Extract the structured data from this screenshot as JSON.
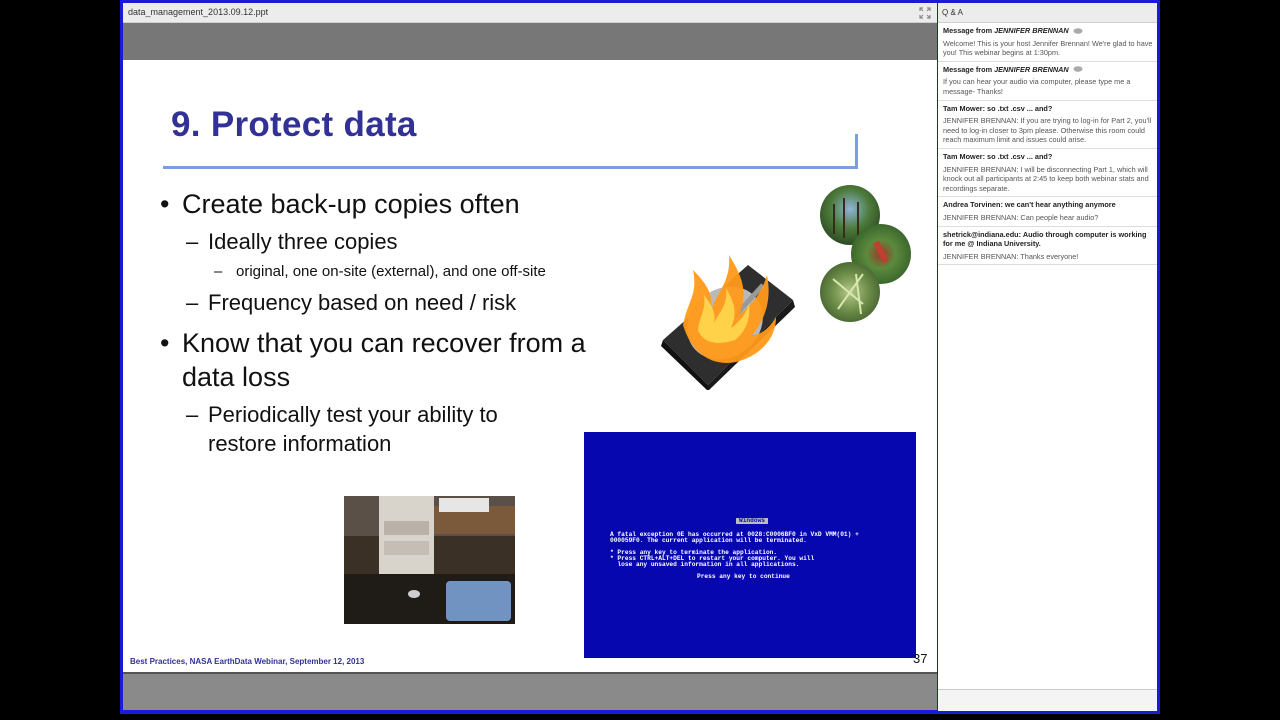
{
  "presentation": {
    "file_name": "data_management_2013.09.12.ppt",
    "expand_icon": "expand-icon"
  },
  "slide": {
    "title": "9.  Protect data",
    "bullets": [
      {
        "text": "Create back-up copies often",
        "sub": [
          {
            "text": "Ideally three copies",
            "subsub": [
              "original, one on-site (external), and one off-site"
            ]
          },
          {
            "text": "Frequency based on need / risk"
          }
        ]
      },
      {
        "text_line1": "Know that you can recover from a",
        "text_line2": "data loss",
        "sub": [
          {
            "line1": "Periodically test your ability to",
            "line2": "restore information"
          }
        ]
      }
    ],
    "footer": "Best Practices, NASA EarthData Webinar, September 12, 2013",
    "page_number": "37",
    "bsod": {
      "badge": "Windows",
      "lines": [
        "A fatal exception 0E has occurred at 0028:C0006BF0 in VxD VMM(01) +",
        "000059F0. The current application will be terminated.",
        "* Press any key to terminate the application.",
        "* Press CTRL+ALT+DEL to restart your computer. You will",
        "  lose any unsaved information in all applications.",
        "Press any key to continue"
      ]
    },
    "colors": {
      "title": "#323296",
      "rule": "#7a9ee0",
      "bsod_bg": "#0707b0"
    }
  },
  "qa": {
    "header": "Q & A",
    "messages": [
      {
        "from_prefix": "Message from",
        "from_name": "JENNIFER BRENNAN",
        "body": "Welcome!  This is your host Jennifer Brennan! We're glad to have you! This webinar begins at 1:30pm."
      },
      {
        "from_prefix": "Message from",
        "from_name": "JENNIFER BRENNAN",
        "body": "If you can hear your audio via computer, please type me a message- Thanks!"
      }
    ],
    "questions": [
      {
        "q": "Tam Mower: so .txt .csv ... and?",
        "a": "JENNIFER BRENNAN: If you are trying to log-in for Part 2, you'll need to log-in closer to 3pm please. Otherwise this room could reach maximum limit and issues could arise."
      },
      {
        "q": "Tam Mower: so .txt .csv ... and?",
        "a": "JENNIFER BRENNAN: I will be disconnecting Part 1, which will knock out all participants at 2:45 to keep both webinar stats and recordings separate."
      },
      {
        "q": "Andrea Torvinen: we can't hear anything anymore",
        "a": "JENNIFER BRENNAN: Can people hear audio?"
      },
      {
        "q": "shetrick@indiana.edu: Audio through computer is working for me @ Indiana University.",
        "a": "JENNIFER BRENNAN: Thanks everyone!"
      }
    ]
  }
}
